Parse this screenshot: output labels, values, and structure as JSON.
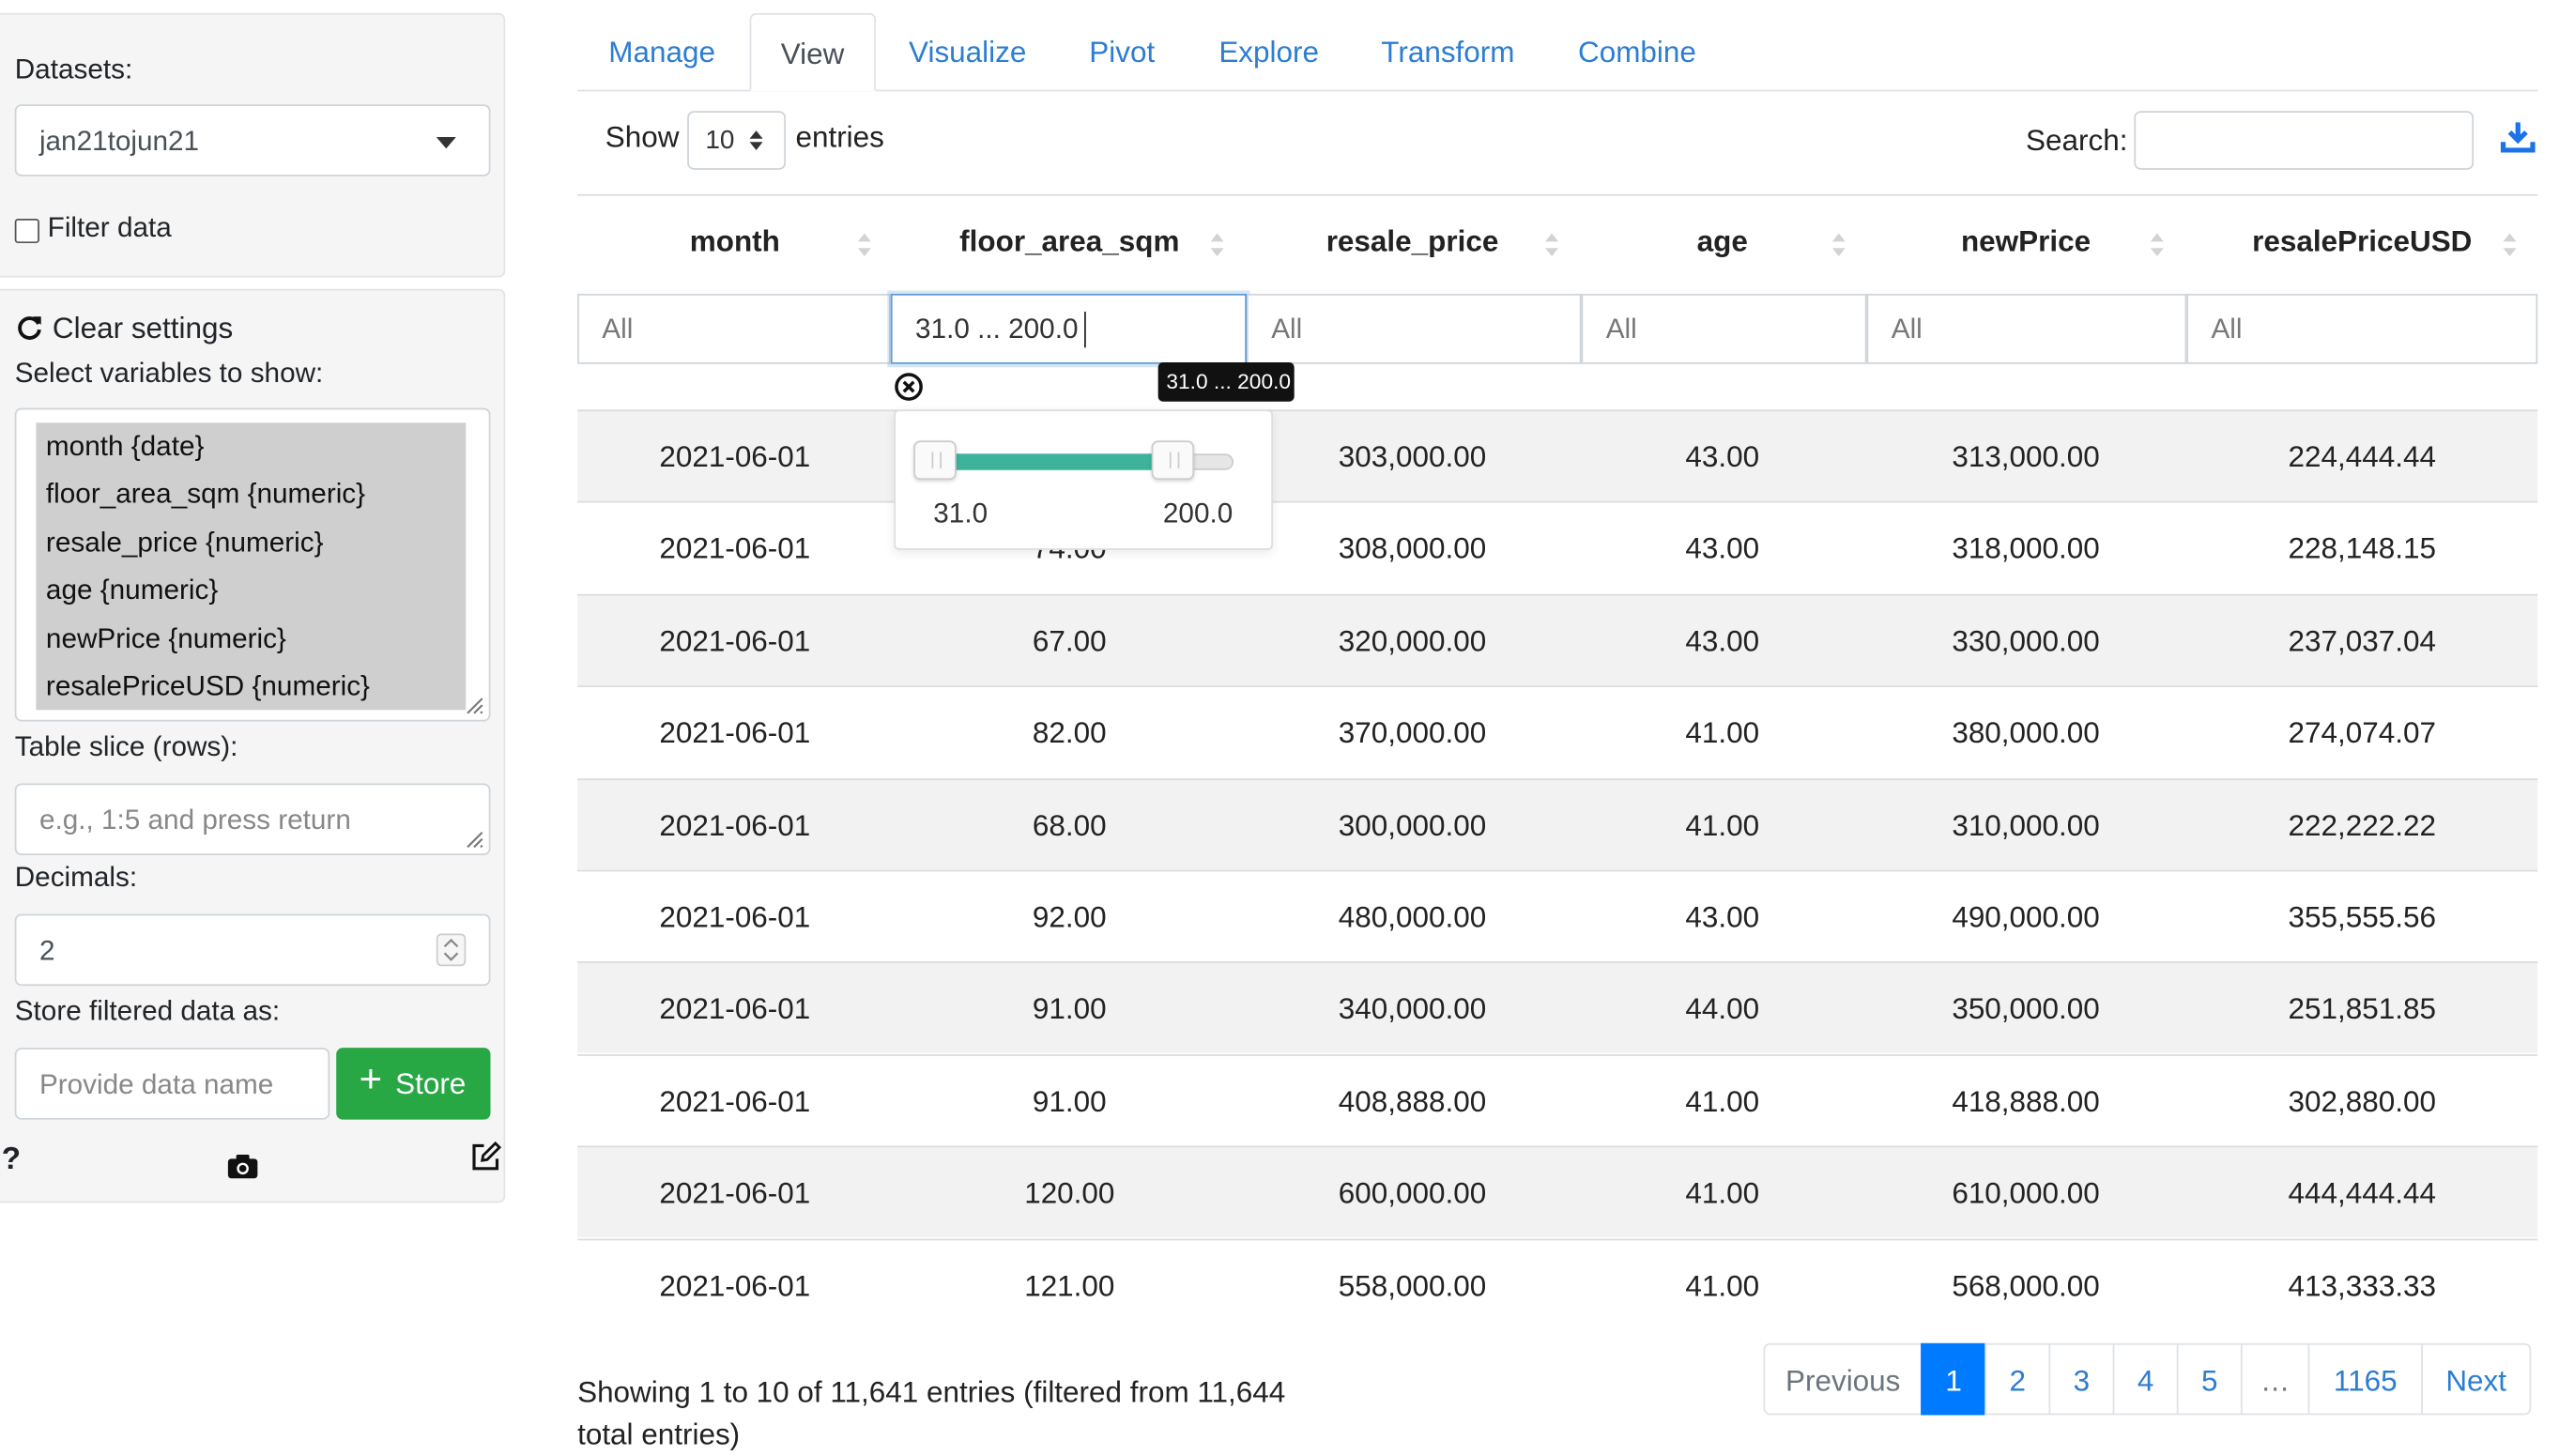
{
  "sidebar": {
    "datasets_label": "Datasets:",
    "dataset_selected": "jan21tojun21",
    "filter_label": "Filter data",
    "clear_settings": "Clear settings",
    "select_vars_label": "Select variables to show:",
    "variables": [
      "month {date}",
      "floor_area_sqm {numeric}",
      "resale_price {numeric}",
      "age {numeric}",
      "newPrice {numeric}",
      "resalePriceUSD {numeric}"
    ],
    "table_slice_label": "Table slice (rows):",
    "table_slice_placeholder": "e.g., 1:5 and press return",
    "decimals_label": "Decimals:",
    "decimals_value": "2",
    "store_label": "Store filtered data as:",
    "store_placeholder": "Provide data name",
    "store_button": "Store",
    "help": "?"
  },
  "tabs": [
    "Manage",
    "View",
    "Visualize",
    "Pivot",
    "Explore",
    "Transform",
    "Combine"
  ],
  "active_tab": "View",
  "controls": {
    "show_label": "Show",
    "page_length": "10",
    "entries_label": "entries",
    "search_label": "Search:"
  },
  "table": {
    "columns": [
      "month",
      "floor_area_sqm",
      "resale_price",
      "age",
      "newPrice",
      "resalePriceUSD"
    ],
    "filters": [
      "All",
      "31.0 ... 200.0",
      "All",
      "All",
      "All",
      "All"
    ],
    "tooltip": "31.0 ... 200.0",
    "slider": {
      "min_label": "31.0",
      "max_label": "200.0"
    },
    "rows": [
      [
        "2021-06-01",
        "",
        "303,000.00",
        "43.00",
        "313,000.00",
        "224,444.44"
      ],
      [
        "2021-06-01",
        "74.00",
        "308,000.00",
        "43.00",
        "318,000.00",
        "228,148.15"
      ],
      [
        "2021-06-01",
        "67.00",
        "320,000.00",
        "43.00",
        "330,000.00",
        "237,037.04"
      ],
      [
        "2021-06-01",
        "82.00",
        "370,000.00",
        "41.00",
        "380,000.00",
        "274,074.07"
      ],
      [
        "2021-06-01",
        "68.00",
        "300,000.00",
        "41.00",
        "310,000.00",
        "222,222.22"
      ],
      [
        "2021-06-01",
        "92.00",
        "480,000.00",
        "43.00",
        "490,000.00",
        "355,555.56"
      ],
      [
        "2021-06-01",
        "91.00",
        "340,000.00",
        "44.00",
        "350,000.00",
        "251,851.85"
      ],
      [
        "2021-06-01",
        "91.00",
        "408,888.00",
        "41.00",
        "418,888.00",
        "302,880.00"
      ],
      [
        "2021-06-01",
        "120.00",
        "600,000.00",
        "41.00",
        "610,000.00",
        "444,444.44"
      ],
      [
        "2021-06-01",
        "121.00",
        "558,000.00",
        "41.00",
        "568,000.00",
        "413,333.33"
      ]
    ]
  },
  "footer": {
    "info": "Showing 1 to 10 of 11,641 entries (filtered from 11,644 total entries)",
    "pagination": [
      "Previous",
      "1",
      "2",
      "3",
      "4",
      "5",
      "…",
      "1165",
      "Next"
    ]
  }
}
